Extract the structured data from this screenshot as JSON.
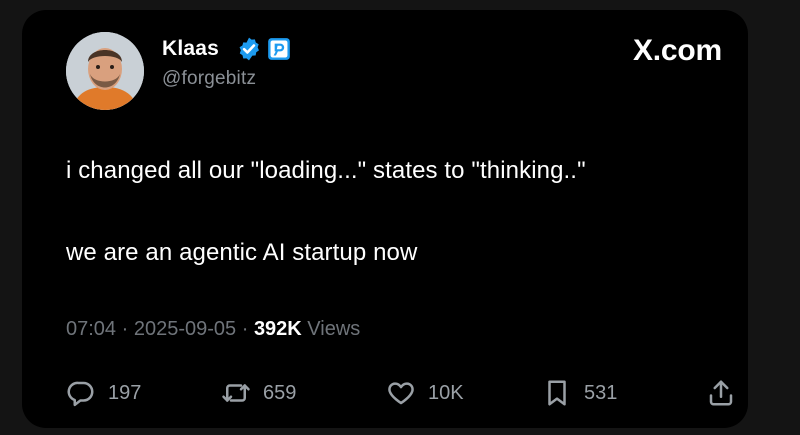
{
  "author": {
    "name": "Klaas",
    "handle": "@forgebitz"
  },
  "brand": "X.com",
  "tweet": {
    "lines": [
      "i changed all our \"loading...\" states to \"thinking..\"",
      "we are an agentic AI startup now"
    ]
  },
  "meta": {
    "time": "07:04",
    "sep1": " · ",
    "date": "2025-09-05",
    "sep2": " · ",
    "views_count": "392K",
    "views_label": " Views"
  },
  "actions": {
    "replies": "197",
    "reposts": "659",
    "likes": "10K",
    "bookmarks": "531"
  },
  "colors": {
    "background": "#000000",
    "verified_badge": "#1d9bf0",
    "affiliate_badge": "#1d9bf0",
    "muted_text": "#6f747a"
  },
  "icons": {
    "reply": "reply-icon",
    "repost": "repost-icon",
    "like": "heart-icon",
    "bookmark": "bookmark-icon",
    "share": "share-icon",
    "verified": "verified-badge-icon",
    "affiliate": "affiliate-badge-icon"
  }
}
